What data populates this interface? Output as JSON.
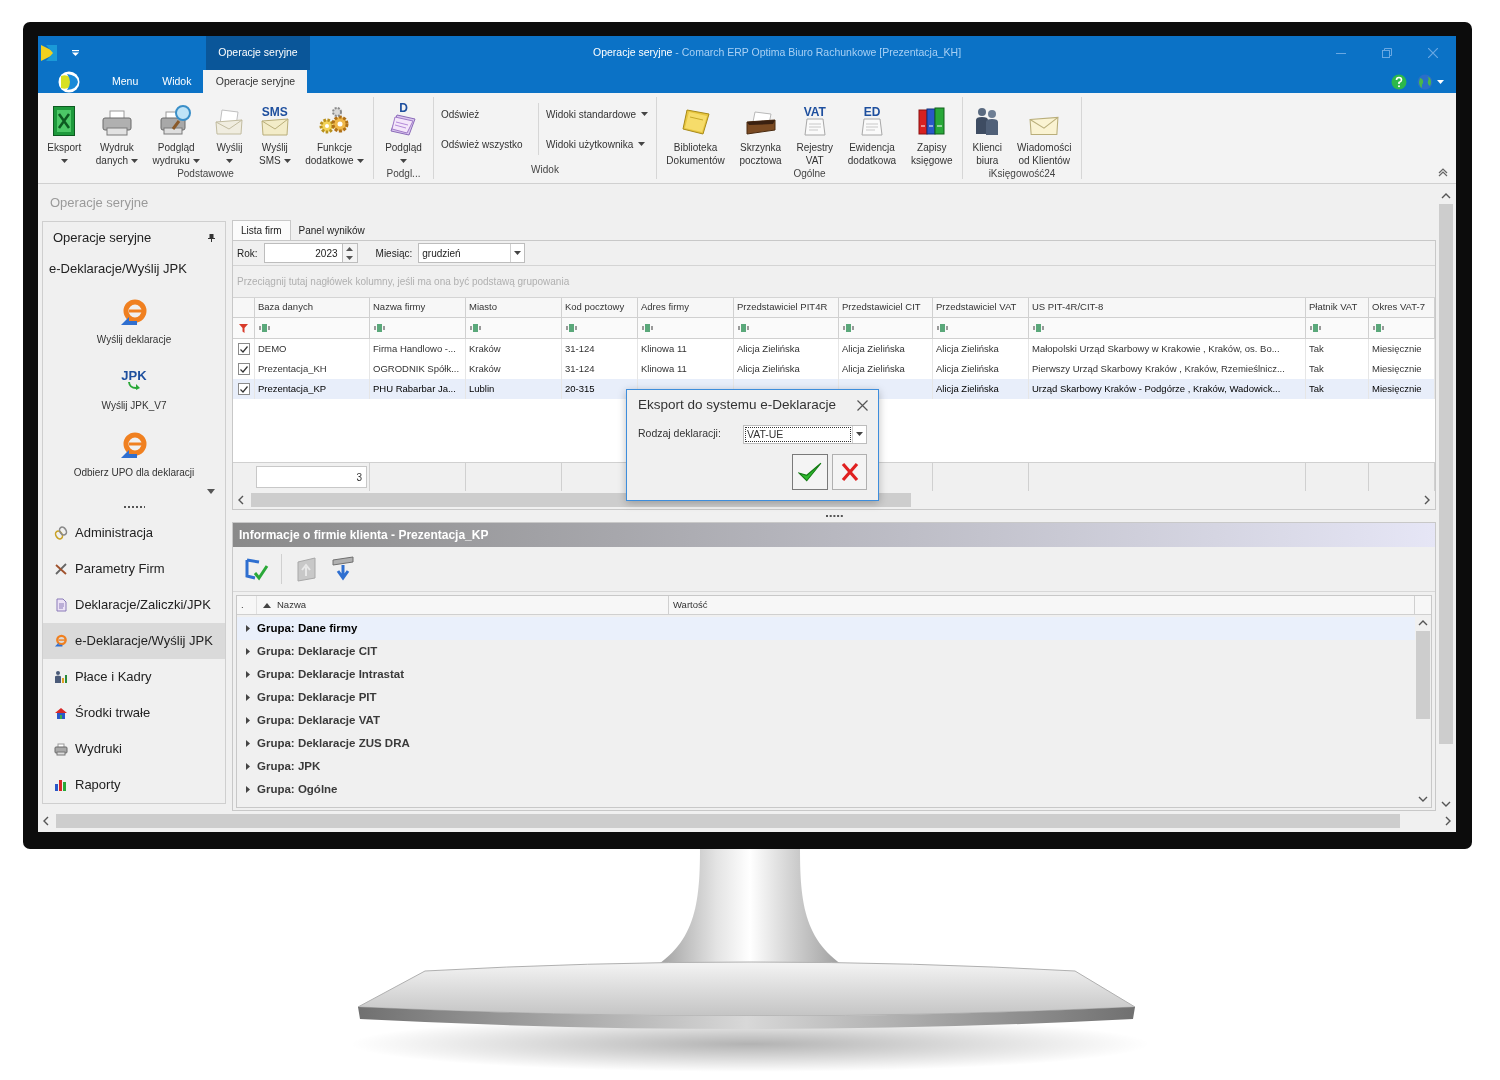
{
  "window": {
    "context_tab_group": "Operacje seryjne",
    "title_context": "Operacje seryjne",
    "title_app": "- Comarch ERP Optima Biuro Rachunkowe [Prezentacja_KH]"
  },
  "ribbon_tabs": [
    {
      "label": "Menu",
      "selected": false
    },
    {
      "label": "Widok",
      "selected": false
    },
    {
      "label": "Operacje seryjne",
      "selected": true
    }
  ],
  "ribbon_groups": [
    {
      "label": "Podstawowe",
      "items": [
        {
          "kind": "large",
          "lines": [
            "Eksport"
          ],
          "menu": true
        },
        {
          "kind": "large",
          "lines": [
            "Wydruk",
            "danych"
          ],
          "menu": true
        },
        {
          "kind": "large",
          "lines": [
            "Podgląd",
            "wydruku"
          ],
          "menu": true
        },
        {
          "kind": "large",
          "lines": [
            "Wyślij"
          ],
          "menu": true
        },
        {
          "kind": "large",
          "icon_text": "SMS",
          "lines": [
            "Wyślij",
            "SMS"
          ],
          "menu": true
        },
        {
          "kind": "large",
          "lines": [
            "Funkcje",
            "dodatkowe"
          ],
          "menu": true
        }
      ]
    },
    {
      "label": "Podgl...",
      "items": [
        {
          "kind": "large",
          "icon_text": "D",
          "lines": [
            "Podgląd"
          ],
          "menu": true
        }
      ]
    },
    {
      "label": "Widok",
      "items": [
        {
          "kind": "small",
          "label": "Odśwież",
          "menu": false
        },
        {
          "kind": "small",
          "label": "Odśwież wszystko",
          "menu": false
        },
        {
          "kind": "small",
          "label": "Widoki standardowe",
          "menu": true
        },
        {
          "kind": "small",
          "label": "Widoki użytkownika",
          "menu": true
        }
      ]
    },
    {
      "label": "Ogólne",
      "items": [
        {
          "kind": "large",
          "lines": [
            "Biblioteka",
            "Dokumentów"
          ],
          "menu": false
        },
        {
          "kind": "large",
          "lines": [
            "Skrzynka",
            "pocztowa"
          ],
          "menu": false
        },
        {
          "kind": "large",
          "icon_text": "VAT",
          "lines": [
            "Rejestry",
            "VAT"
          ],
          "menu": false
        },
        {
          "kind": "large",
          "icon_text": "ED",
          "lines": [
            "Ewidencja",
            "dodatkowa"
          ],
          "menu": false
        },
        {
          "kind": "large",
          "lines": [
            "Zapisy",
            "księgowe"
          ],
          "menu": false
        }
      ]
    },
    {
      "label": "iKsięgowość24",
      "items": [
        {
          "kind": "large",
          "lines": [
            "Klienci",
            "biura"
          ],
          "menu": false
        },
        {
          "kind": "large",
          "lines": [
            "Wiadomości",
            "od Klientów"
          ],
          "menu": false
        }
      ]
    }
  ],
  "sidebar": {
    "breadcrumb": "Operacje seryjne",
    "panel_title": "Operacje seryjne",
    "section_title": "e-Deklaracje/Wyślij JPK",
    "actions": [
      {
        "label": "Wyślij deklaracje"
      },
      {
        "label": "Wyślij JPK_V7",
        "icon_text": "JPK"
      },
      {
        "label": "Odbierz UPO dla deklaracji"
      }
    ],
    "nav": [
      {
        "label": "Administracja",
        "selected": false
      },
      {
        "label": "Parametry Firm",
        "selected": false
      },
      {
        "label": "Deklaracje/Zaliczki/JPK",
        "selected": false
      },
      {
        "label": "e-Deklaracje/Wyślij JPK",
        "selected": true
      },
      {
        "label": "Płace i Kadry",
        "selected": false
      },
      {
        "label": "Środki trwałe",
        "selected": false
      },
      {
        "label": "Wydruki",
        "selected": false
      },
      {
        "label": "Raporty",
        "selected": false
      }
    ]
  },
  "main": {
    "tabs": [
      {
        "label": "Lista firm",
        "selected": true
      },
      {
        "label": "Panel wyników",
        "selected": false
      }
    ],
    "year_label": "Rok:",
    "year": "2023",
    "month_label": "Miesiąc:",
    "month": "grudzień",
    "group_hint": "Przeciągnij tutaj nagłówek kolumny, jeśli ma ona być podstawą grupowania",
    "columns": [
      "Baza danych",
      "Nazwa firmy",
      "Miasto",
      "Kod pocztowy",
      "Adres firmy",
      "Przedstawiciel PIT4R",
      "Przedstawiciel CIT",
      "Przedstawiciel VAT",
      "US PIT-4R/CIT-8",
      "Płatnik VAT",
      "Okres VAT-7"
    ],
    "rows": [
      {
        "checked": true,
        "selected": false,
        "cells": [
          "DEMO",
          "Firma Handlowo -...",
          "Kraków",
          "31-124",
          "Klinowa 11",
          "Alicja Zielińska",
          "Alicja Zielińska",
          "Alicja Zielińska",
          "Małopolski Urząd Skarbowy w Krakowie , Kraków, os. Bo...",
          "Tak",
          "Miesięcznie"
        ]
      },
      {
        "checked": true,
        "selected": false,
        "cells": [
          "Prezentacja_KH",
          "OGRODNIK Spółk...",
          "Kraków",
          "31-124",
          "Klinowa 11",
          "Alicja Zielińska",
          "Alicja Zielińska",
          "Alicja Zielińska",
          "Pierwszy Urząd Skarbowy Kraków , Kraków, Rzemieślnicz...",
          "Tak",
          "Miesięcznie"
        ]
      },
      {
        "checked": true,
        "selected": true,
        "cells": [
          "Prezentacja_KP",
          "PHU Rabarbar Ja...",
          "Lublin",
          "20-315",
          null,
          null,
          null,
          "Alicja Zielińska",
          "Urząd Skarbowy Kraków - Podgórze , Kraków, Wadowick...",
          "Tak",
          "Miesięcznie"
        ]
      }
    ],
    "count": "3"
  },
  "info": {
    "title": "Informacje o firmie klienta - Prezentacja_KP",
    "toolbar": [
      {
        "disabled": false
      },
      {
        "disabled": true
      },
      {
        "disabled": false
      }
    ],
    "header_marker": ".",
    "name_column": "Nazwa",
    "value_column": "Wartość",
    "rows": [
      {
        "label": "Grupa: Dane firmy",
        "selected": true,
        "expanded": false
      },
      {
        "label": "Grupa: Deklaracje CIT",
        "selected": false,
        "expanded": false
      },
      {
        "label": "Grupa: Deklaracje Intrastat",
        "selected": false,
        "expanded": false
      },
      {
        "label": "Grupa: Deklaracje PIT",
        "selected": false,
        "expanded": false
      },
      {
        "label": "Grupa: Deklaracje VAT",
        "selected": false,
        "expanded": false
      },
      {
        "label": "Grupa: Deklaracje ZUS DRA",
        "selected": false,
        "expanded": false
      },
      {
        "label": "Grupa: JPK",
        "selected": false,
        "expanded": false
      },
      {
        "label": "Grupa: Ogólne",
        "selected": false,
        "expanded": false
      }
    ]
  },
  "dialog": {
    "title": "Eksport do systemu e-Deklaracje",
    "field_label": "Rodzaj deklaracji:",
    "field_value": "VAT-UE"
  }
}
